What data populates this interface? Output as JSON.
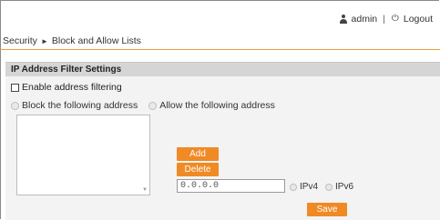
{
  "header": {
    "user_icon": "user-icon",
    "username": "admin",
    "separator": "|",
    "logout_icon": "power-icon",
    "logout_label": "Logout"
  },
  "breadcrumb": {
    "parent": "Security",
    "arrow": "►",
    "current": "Block and Allow Lists"
  },
  "section": {
    "title": "IP Address Filter Settings",
    "enable_label": "Enable address filtering",
    "enable_checked": false,
    "block_label": "Block the following address",
    "allow_label": "Allow the following address",
    "add_label": "Add",
    "delete_label": "Delete",
    "ip_value": "0.0.0.0",
    "ipv4_label": "IPv4",
    "ipv6_label": "IPv6",
    "save_label": "Save"
  },
  "colors": {
    "accent": "#f08a24",
    "header_band": "#d5d5d5",
    "panel_bg": "#f3f3f3"
  }
}
